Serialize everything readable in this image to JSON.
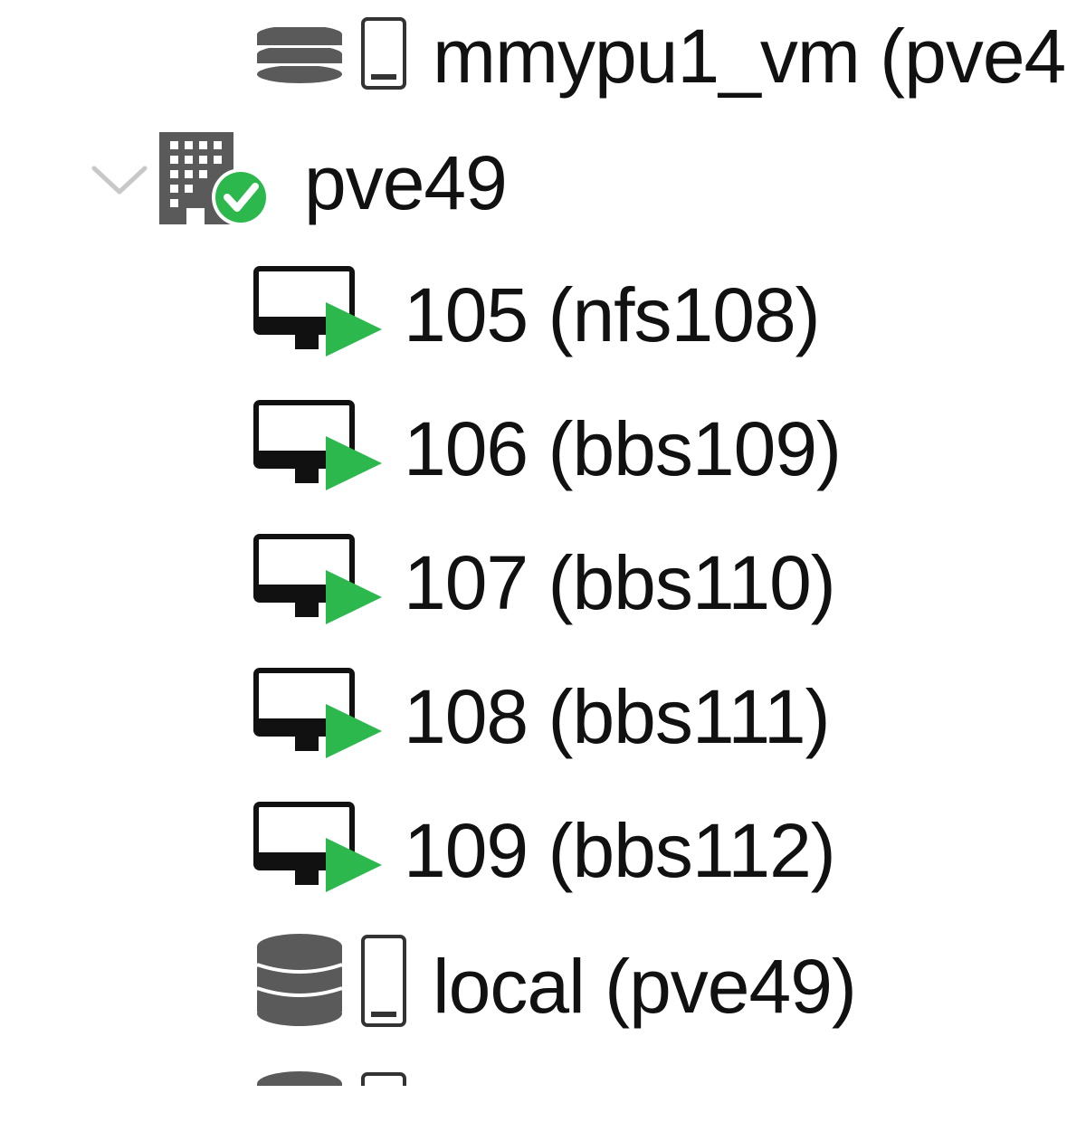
{
  "tree": {
    "top_storage_partial": {
      "label": "mmypu1_vm (pve4",
      "icon": "storage-icon"
    },
    "node": {
      "label": "pve49",
      "status": "online",
      "expanded": true,
      "icon": "server-online-icon",
      "toggle_icon": "chevron-down-icon"
    },
    "vms": [
      {
        "label": "105 (nfs108)",
        "status": "running",
        "icon": "vm-running-icon"
      },
      {
        "label": "106 (bbs109)",
        "status": "running",
        "icon": "vm-running-icon"
      },
      {
        "label": "107 (bbs110)",
        "status": "running",
        "icon": "vm-running-icon"
      },
      {
        "label": "108 (bbs111)",
        "status": "running",
        "icon": "vm-running-icon"
      },
      {
        "label": "109 (bbs112)",
        "status": "running",
        "icon": "vm-running-icon"
      }
    ],
    "storages": [
      {
        "label": "local (pve49)",
        "icon": "storage-icon"
      }
    ]
  },
  "colors": {
    "status_green": "#2db84d",
    "icon_gray": "#5a5a5a",
    "icon_black": "#111111",
    "chevron_gray": "#c8c8c8"
  }
}
